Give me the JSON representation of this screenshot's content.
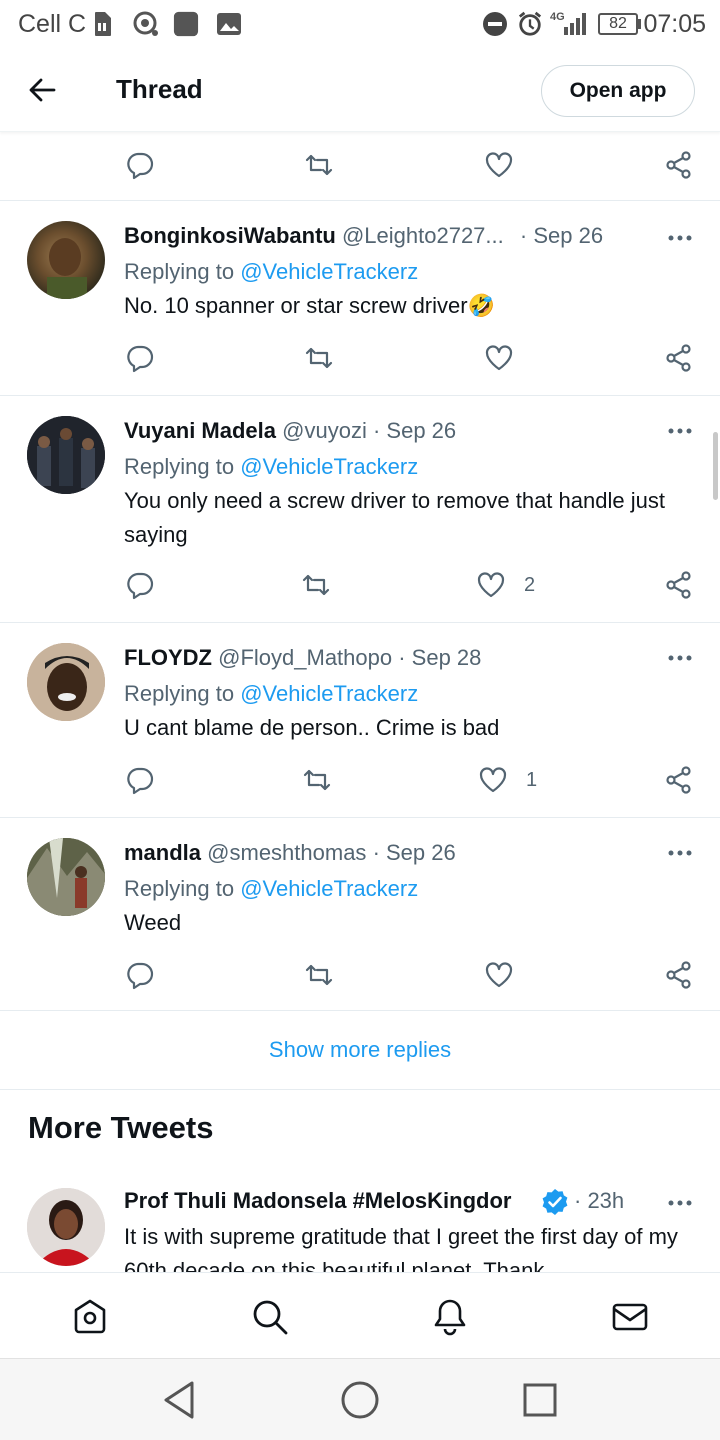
{
  "status_bar": {
    "carrier": "Cell C",
    "network": "4G",
    "battery": "82",
    "time": "07:05",
    "icons": [
      "sim-icon",
      "hotspot-icon",
      "app-icon",
      "gallery-icon",
      "dnd-icon",
      "alarm-icon",
      "signal-icon",
      "battery-icon"
    ]
  },
  "header": {
    "title": "Thread",
    "open_app_label": "Open app",
    "back_icon": "arrow-left-icon"
  },
  "tweets": [
    {
      "name": "BonginkosiWabantu",
      "handle": "@Leighto2727...",
      "date": "· Sep 26",
      "replying_label": "Replying to",
      "replying_to": "@VehicleTrackerz",
      "text": "No. 10 spanner or star screw driver🤣",
      "likes": ""
    },
    {
      "name": "Vuyani Madela",
      "handle": "@vuyozi",
      "date": "· Sep 26",
      "replying_label": "Replying to",
      "replying_to": "@VehicleTrackerz",
      "text": "You only need a screw driver to remove that handle just saying",
      "likes": "2"
    },
    {
      "name": "FLOYDZ",
      "handle": "@Floyd_Mathopo",
      "date": "· Sep 28",
      "replying_label": "Replying to",
      "replying_to": "@VehicleTrackerz",
      "text": "U cant blame de person.. Crime is bad",
      "likes": "1"
    },
    {
      "name": "mandla",
      "handle": "@smeshthomas",
      "date": "· Sep 26",
      "replying_label": "Replying to",
      "replying_to": "@VehicleTrackerz",
      "text": "Weed",
      "likes": ""
    }
  ],
  "show_more_label": "Show more replies",
  "more_tweets": {
    "title": "More Tweets",
    "tweet": {
      "name": "Prof Thuli Madonsela #MelosKingdor",
      "verified_icon": "verified-badge-icon",
      "time": "· 23h",
      "text": "It is with supreme gratitude that I greet the first day of my 60th decade on this beautiful planet. Thank"
    }
  },
  "colors": {
    "accent": "#1d9bf0",
    "muted": "#536471",
    "text": "#0f1419"
  },
  "bottom_nav": [
    "home-icon",
    "search-icon",
    "notifications-icon",
    "messages-icon"
  ],
  "android_nav": [
    "back-triangle-icon",
    "home-circle-icon",
    "recents-square-icon"
  ]
}
